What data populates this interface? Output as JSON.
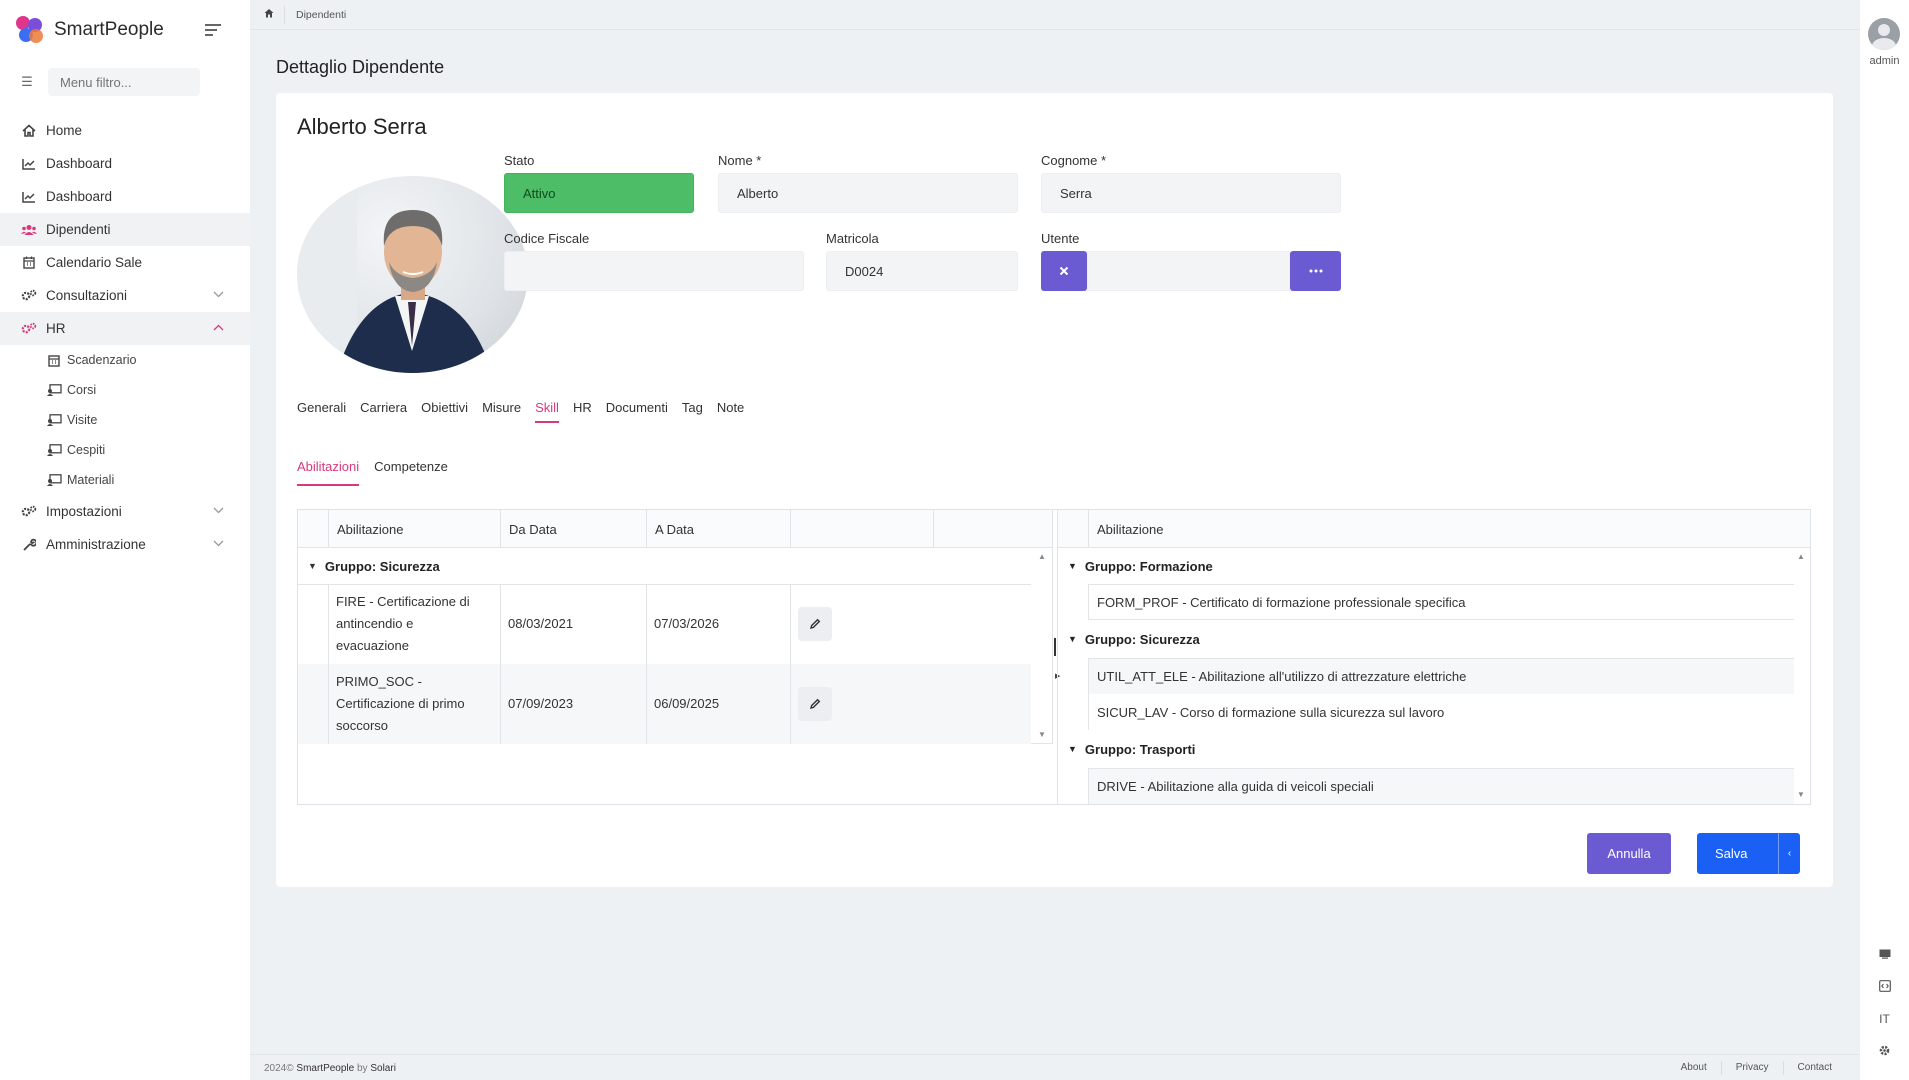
{
  "app": {
    "name": "SmartPeople"
  },
  "sidebar": {
    "filter_placeholder": "Menu filtro...",
    "items": [
      {
        "label": "Home",
        "icon": "home-icon"
      },
      {
        "label": "Dashboard",
        "icon": "chart-line-icon"
      },
      {
        "label": "Dashboard",
        "icon": "chart-line-icon"
      },
      {
        "label": "Dipendenti",
        "icon": "users-icon",
        "active": true
      },
      {
        "label": "Calendario Sale",
        "icon": "calendar-icon"
      },
      {
        "label": "Consultazioni",
        "icon": "cogs-icon"
      },
      {
        "label": "HR",
        "icon": "cogs-icon",
        "expanded": true
      }
    ],
    "hr_subitems": [
      {
        "label": "Scadenzario",
        "icon": "calendar-icon"
      },
      {
        "label": "Corsi",
        "icon": "screen-user-icon"
      },
      {
        "label": "Visite",
        "icon": "screen-user-icon"
      },
      {
        "label": "Cespiti",
        "icon": "screen-user-icon"
      },
      {
        "label": "Materiali",
        "icon": "screen-user-icon"
      }
    ],
    "bottom_items": [
      {
        "label": "Impostazioni",
        "icon": "cogs-icon"
      },
      {
        "label": "Amministrazione",
        "icon": "wrench-icon"
      }
    ]
  },
  "breadcrumb": {
    "current": "Dipendenti"
  },
  "user": {
    "name": "admin"
  },
  "rail": {
    "lang": "IT"
  },
  "page": {
    "title": "Dettaglio Dipendente"
  },
  "employee": {
    "full_name": "Alberto Serra",
    "stato_label": "Stato",
    "stato_value": "Attivo",
    "nome_label": "Nome *",
    "nome_value": "Alberto",
    "cognome_label": "Cognome *",
    "cognome_value": "Serra",
    "cf_label": "Codice Fiscale",
    "cf_value": "",
    "matricola_label": "Matricola",
    "matricola_value": "D0024",
    "utente_label": "Utente",
    "utente_value": ""
  },
  "tabs": [
    "Generali",
    "Carriera",
    "Obiettivi",
    "Misure",
    "Skill",
    "HR",
    "Documenti",
    "Tag",
    "Note"
  ],
  "active_tab": "Skill",
  "subtabs": [
    "Abilitazioni",
    "Competenze"
  ],
  "active_subtab": "Abilitazioni",
  "left_table": {
    "headers": [
      "Abilitazione",
      "Da Data",
      "A Data"
    ],
    "group": "Gruppo: Sicurezza",
    "rows": [
      {
        "line1": "FIRE - Certificazione di",
        "line2": "antincendio e",
        "line3": "evacuazione",
        "da": "08/03/2021",
        "a": "07/03/2026"
      },
      {
        "line1": "PRIMO_SOC -",
        "line2": "Certificazione di primo",
        "line3": "soccorso",
        "da": "07/09/2023",
        "a": "06/09/2025"
      }
    ]
  },
  "right_table": {
    "header": "Abilitazione",
    "groups": [
      {
        "name": "Gruppo: Formazione",
        "items": [
          "FORM_PROF - Certificato di formazione professionale specifica"
        ]
      },
      {
        "name": "Gruppo: Sicurezza",
        "items": [
          "UTIL_ATT_ELE - Abilitazione all'utilizzo di attrezzature elettriche",
          "SICUR_LAV - Corso di formazione sulla sicurezza sul lavoro"
        ]
      },
      {
        "name": "Gruppo: Trasporti",
        "items": [
          "DRIVE - Abilitazione alla guida di veicoli speciali"
        ]
      }
    ]
  },
  "actions": {
    "cancel": "Annulla",
    "save": "Salva"
  },
  "footer": {
    "copyright_prefix": "2024© ",
    "brand": "SmartPeople",
    "by": " by ",
    "company": "Solari",
    "links": [
      "About",
      "Privacy",
      "Contact"
    ]
  },
  "colors": {
    "accent": "#d63a7d",
    "purple": "#6b5bd2",
    "primary": "#1b60f5",
    "status_green": "#4dbd68"
  }
}
